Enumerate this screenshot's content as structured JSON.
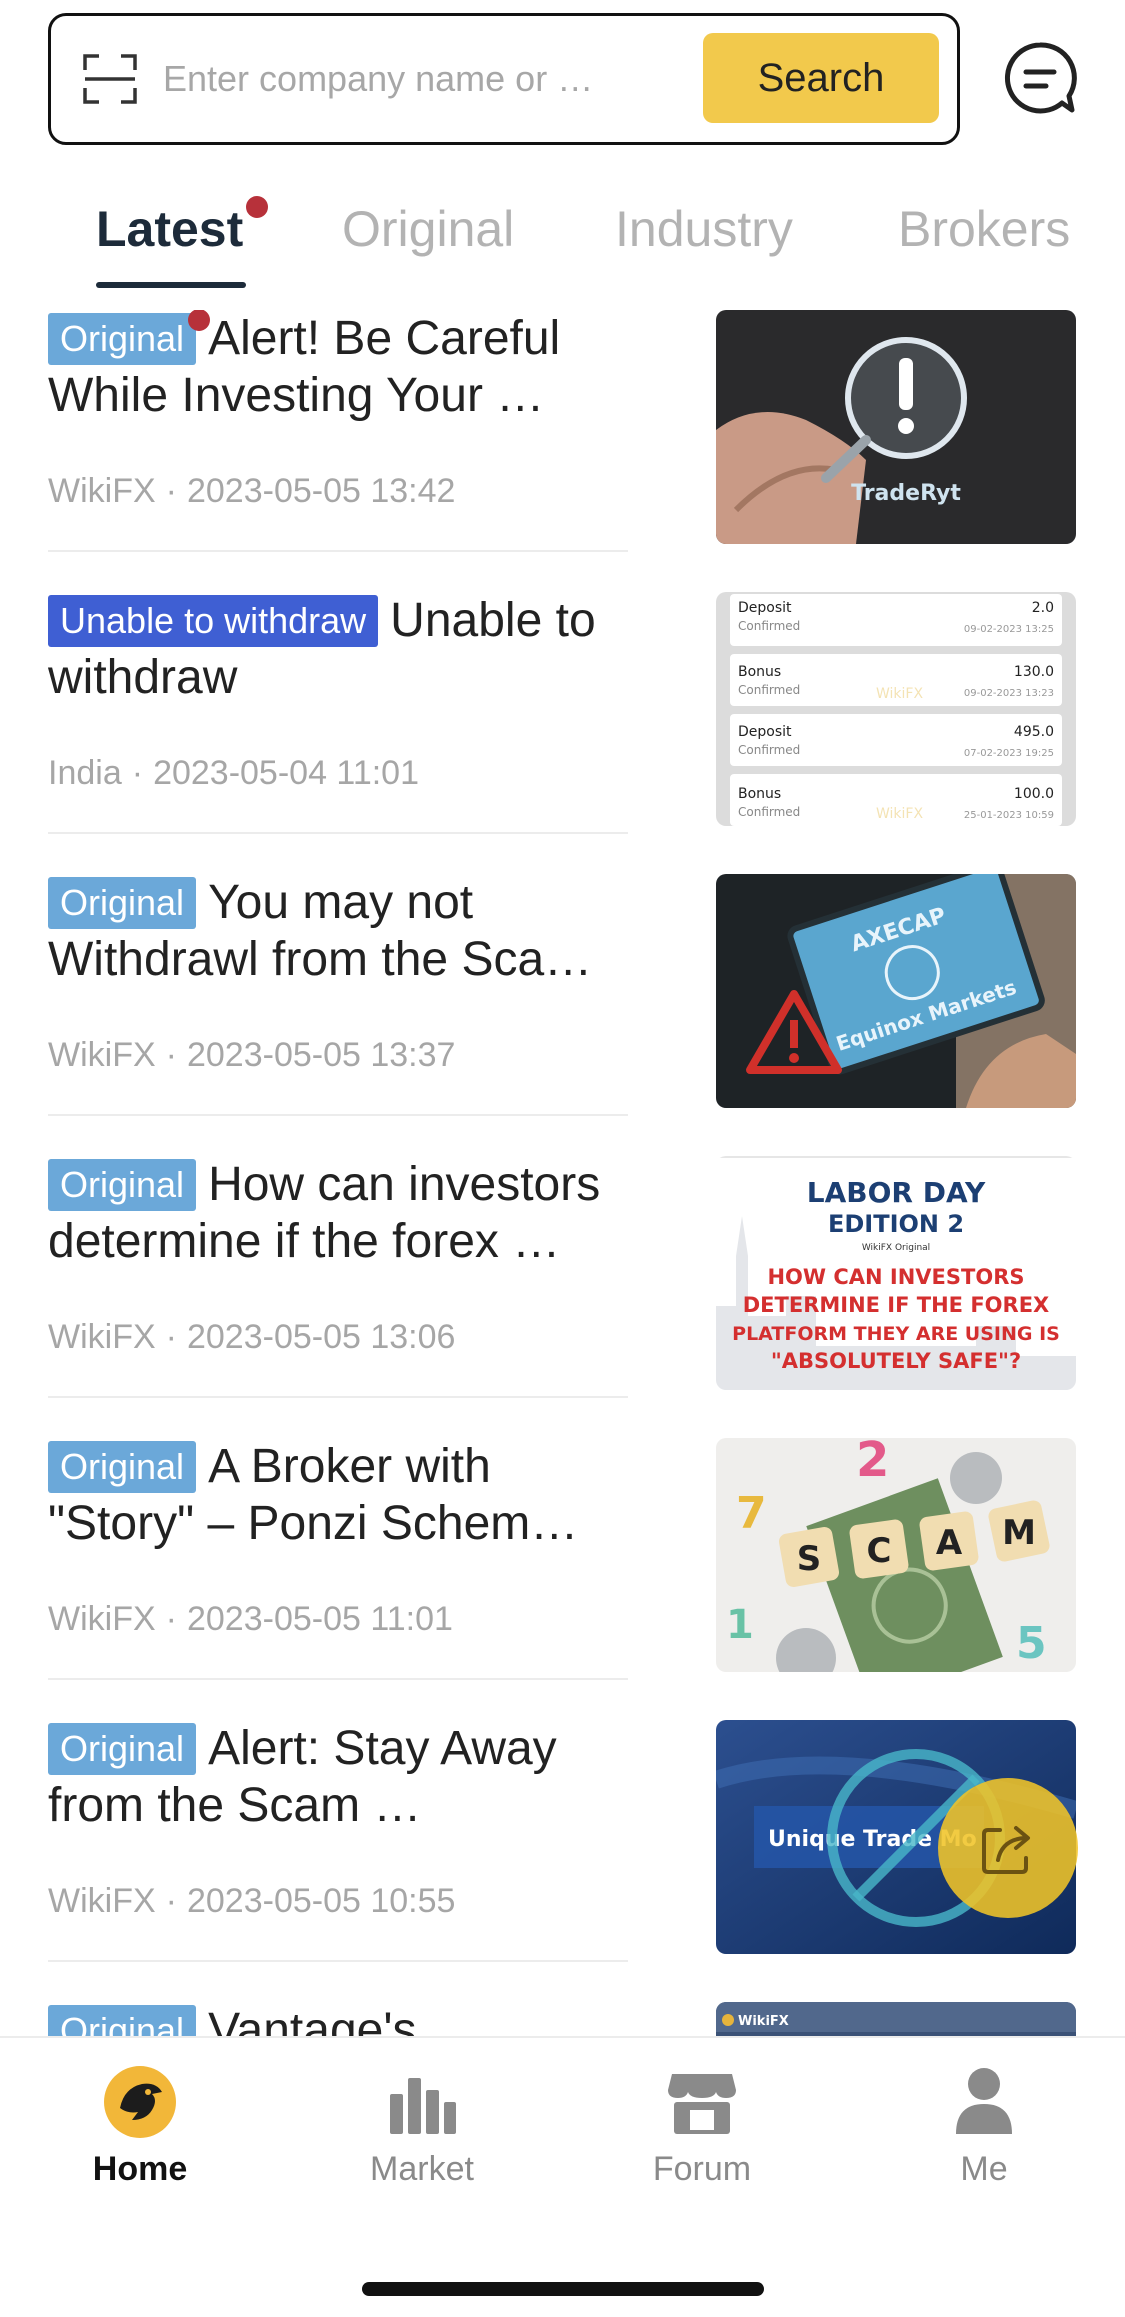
{
  "search": {
    "placeholder": "Enter company name or …",
    "button_label": "Search"
  },
  "tabs": [
    {
      "label": "Latest",
      "active": true,
      "has_dot": true
    },
    {
      "label": "Original",
      "active": false
    },
    {
      "label": "Industry",
      "active": false
    },
    {
      "label": "Brokers",
      "active": false
    }
  ],
  "articles": [
    {
      "tag": "Original",
      "tag_type": "original",
      "tag_dot": true,
      "title": "Alert! Be Careful While Investing Your …",
      "source": "WikiFX",
      "datetime": "2023-05-05 13:42",
      "thumb": {
        "brand_text": "TradeRyt"
      }
    },
    {
      "tag": "Unable to withdraw",
      "tag_type": "withdraw",
      "title": "Unable to withdraw",
      "source": "India",
      "datetime": "2023-05-04 11:01",
      "thumb": {
        "watermark": "WikiFX",
        "rows": [
          {
            "label": "Deposit",
            "status": "Confirmed",
            "amount": "2.0",
            "date": "09-02-2023 13:25"
          },
          {
            "label": "Bonus",
            "status": "Confirmed",
            "amount": "130.0",
            "date": "09-02-2023 13:23"
          },
          {
            "label": "Deposit",
            "status": "Confirmed",
            "amount": "495.0",
            "date": "07-02-2023 19:25"
          },
          {
            "label": "Bonus",
            "status": "Confirmed",
            "amount": "100.0",
            "date": "25-01-2023 10:59"
          }
        ]
      }
    },
    {
      "tag": "Original",
      "tag_type": "original",
      "title": "You may not Withdrawl from the Sca…",
      "source": "WikiFX",
      "datetime": "2023-05-05 13:37",
      "thumb": {
        "line1": "AXECAP",
        "line2": "Equinox Markets"
      }
    },
    {
      "tag": "Original",
      "tag_type": "original",
      "title": "How can investors determine if the forex …",
      "source": "WikiFX",
      "datetime": "2023-05-05 13:06",
      "thumb": {
        "heading1": "LABOR DAY",
        "heading2": "EDITION 2",
        "badge": "WikiFX Original",
        "body": [
          "HOW CAN INVESTORS",
          "DETERMINE IF THE FOREX",
          "PLATFORM THEY ARE USING IS",
          "\"ABSOLUTELY SAFE\"?"
        ]
      }
    },
    {
      "tag": "Original",
      "tag_type": "original",
      "title": "A Broker with \"Story\" – Ponzi Schem…",
      "source": "WikiFX",
      "datetime": "2023-05-05 11:01",
      "thumb": {
        "letters": [
          "S",
          "C",
          "A",
          "M"
        ]
      }
    },
    {
      "tag": "Original",
      "tag_type": "original",
      "title": "Alert: Stay Away from the Scam …",
      "source": "WikiFX",
      "datetime": "2023-05-05 10:55",
      "thumb": {
        "banner_text": "Unique Trade Mo"
      }
    },
    {
      "tag": "Original",
      "tag_type": "original",
      "title": "Vantage's",
      "source": "",
      "datetime": "",
      "thumb": {
        "watermark": "WikiFX"
      }
    }
  ],
  "bottom_nav": [
    {
      "label": "Home",
      "icon": "home-eagle-icon",
      "active": true
    },
    {
      "label": "Market",
      "icon": "bar-chart-icon",
      "active": false
    },
    {
      "label": "Forum",
      "icon": "store-icon",
      "active": false
    },
    {
      "label": "Me",
      "icon": "person-icon",
      "active": false
    }
  ],
  "colors": {
    "accent_yellow": "#f2c94c",
    "tag_original": "#6ba8d9",
    "tag_withdraw": "#3f5fd3",
    "dot_red": "#b7313a",
    "active_text": "#1d2b3a"
  }
}
